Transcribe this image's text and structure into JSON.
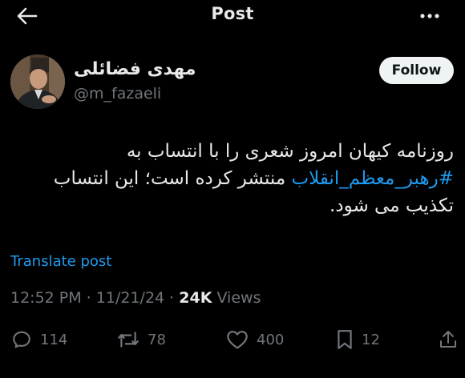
{
  "header": {
    "title": "Post",
    "back_icon": "arrow-left-icon",
    "more_icon": "more-horizontal-icon"
  },
  "author": {
    "name": "مهدی فضائلی",
    "handle": "@m_fazaeli",
    "follow_label": "Follow"
  },
  "tweet": {
    "line1": "روزنامه کیهان امروز شعری را با انتساب به",
    "line2_hashtag": "#رهبر_معظم_انقلاب",
    "line2_rest": " منتشر کرده است؛ این انتساب",
    "line3": "تکذیب می شود."
  },
  "translate_label": "Translate post",
  "meta": {
    "time": "12:52 PM",
    "separator1": " · ",
    "date": "11/21/24",
    "separator2": " · ",
    "views_count": "24K",
    "views_label": " Views"
  },
  "actions": {
    "replies": "114",
    "reposts": "78",
    "likes": "400",
    "bookmarks": "12"
  },
  "colors": {
    "background": "#000000",
    "text": "#e7e9ea",
    "muted": "#71767b",
    "link": "#1d9bf0",
    "follow_bg": "#eff3f4"
  }
}
